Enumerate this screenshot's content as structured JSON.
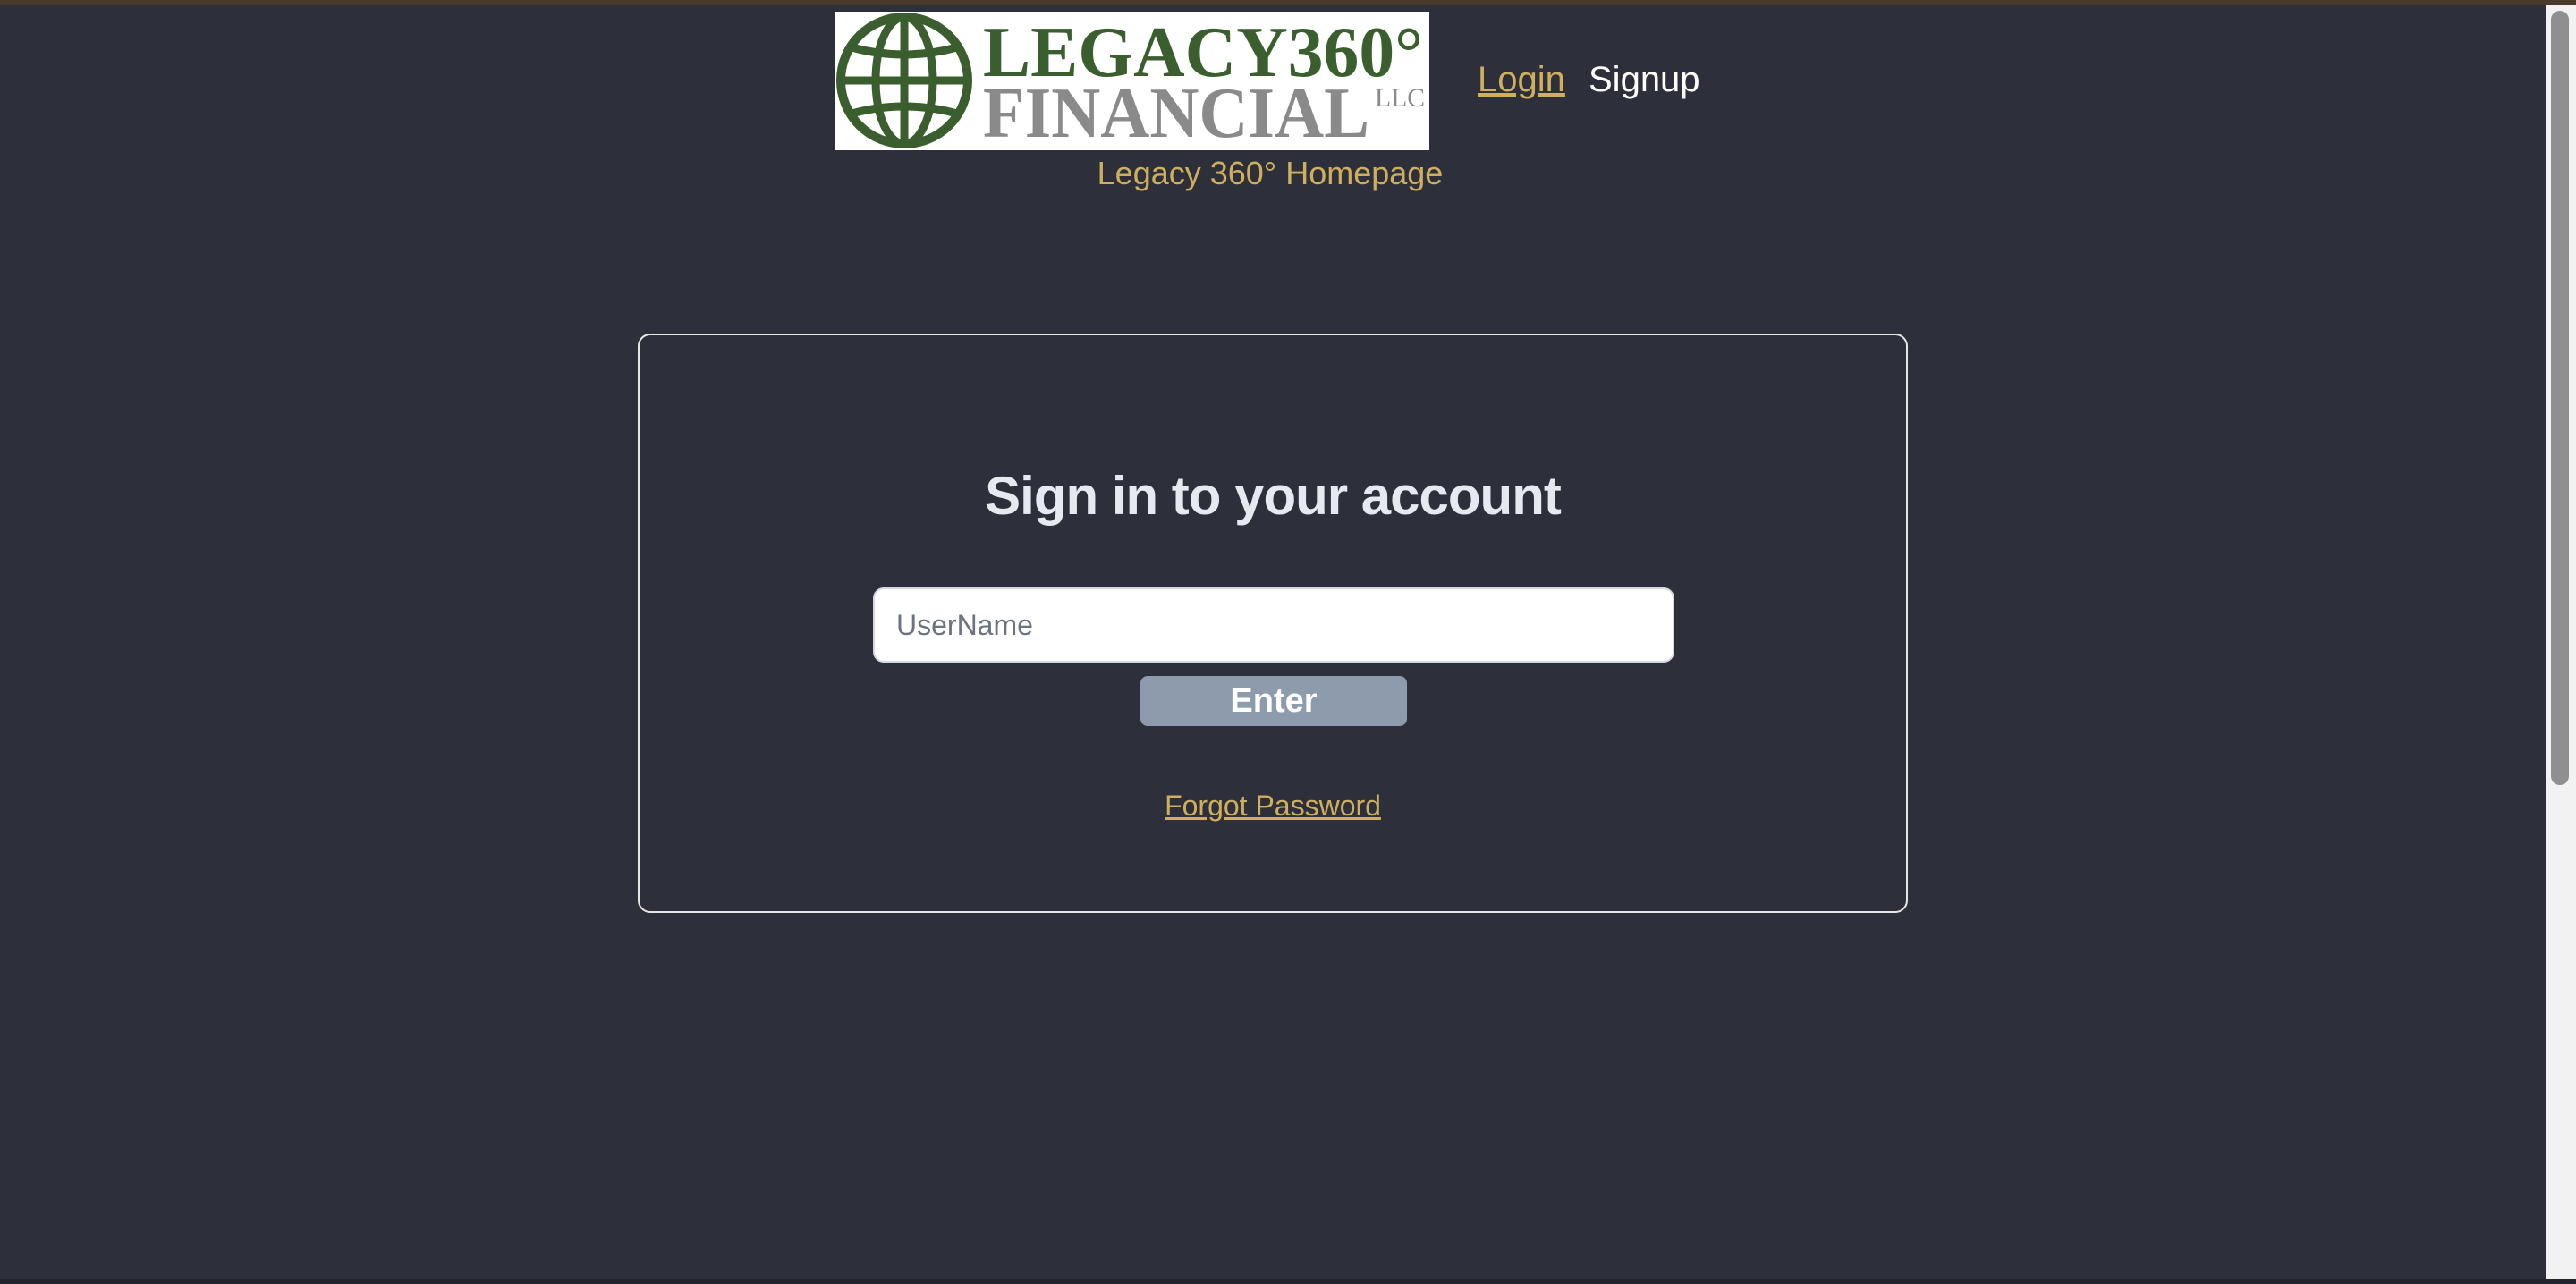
{
  "header": {
    "logo": {
      "line1": "LEGACY360°",
      "line2": "FINANCIAL",
      "suffix": "LLC",
      "icon": "globe-icon"
    },
    "nav": {
      "login_label": "Login",
      "signup_label": "Signup"
    },
    "home_link_label": "Legacy 360° Homepage"
  },
  "login_card": {
    "title": "Sign in to your account",
    "username_placeholder": "UserName",
    "username_value": "",
    "enter_label": "Enter",
    "forgot_password_label": "Forgot Password"
  },
  "colors": {
    "background": "#2d303b",
    "accent_gold": "#cfae5e",
    "logo_green": "#3a5e2e",
    "logo_gray": "#8a8a8a",
    "button_gray": "#8e9bad"
  }
}
